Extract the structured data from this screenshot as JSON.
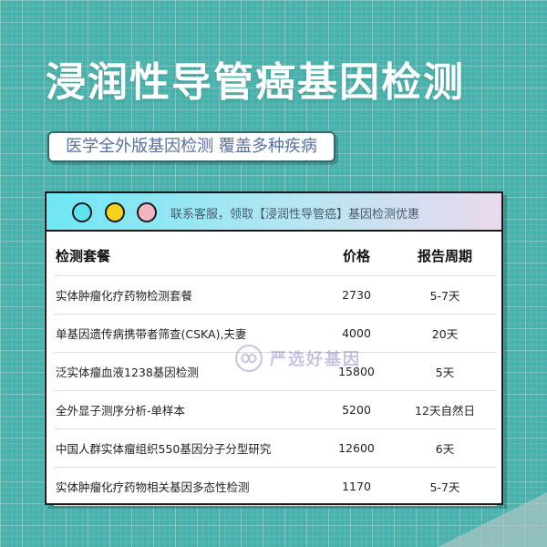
{
  "title": "浸润性导管癌基因检测",
  "subtitle": "医学全外版基因检测 覆盖多种疾病",
  "card": {
    "notice": "联系客服，领取【浸润性导管癌】基因检测优惠",
    "dots": [
      "#5ee3f0",
      "#f5d21b",
      "#f6b4bf"
    ]
  },
  "table": {
    "headers": [
      "检测套餐",
      "价格",
      "报告周期"
    ],
    "rows": [
      {
        "name": "实体肿瘤化疗药物检测套餐",
        "price": "2730",
        "period": "5-7天"
      },
      {
        "name": "单基因遗传病携带者筛查(CSKA),夫妻",
        "price": "4000",
        "period": "20天"
      },
      {
        "name": "泛实体瘤血液1238基因检测",
        "price": "15800",
        "period": "5天"
      },
      {
        "name": "全外显子测序分析-单样本",
        "price": "5200",
        "period": "12天自然日"
      },
      {
        "name": "中国人群实体瘤组织550基因分子分型研究",
        "price": "12600",
        "period": "6天"
      },
      {
        "name": "实体肿瘤化疗药物相关基因多态性检测",
        "price": "1170",
        "period": "5-7天"
      }
    ]
  },
  "watermark": {
    "text": "严选好基因"
  },
  "colors": {
    "background": "#48b3ad",
    "title": "#ffffff",
    "subtitle_text": "#5a6fa8"
  }
}
